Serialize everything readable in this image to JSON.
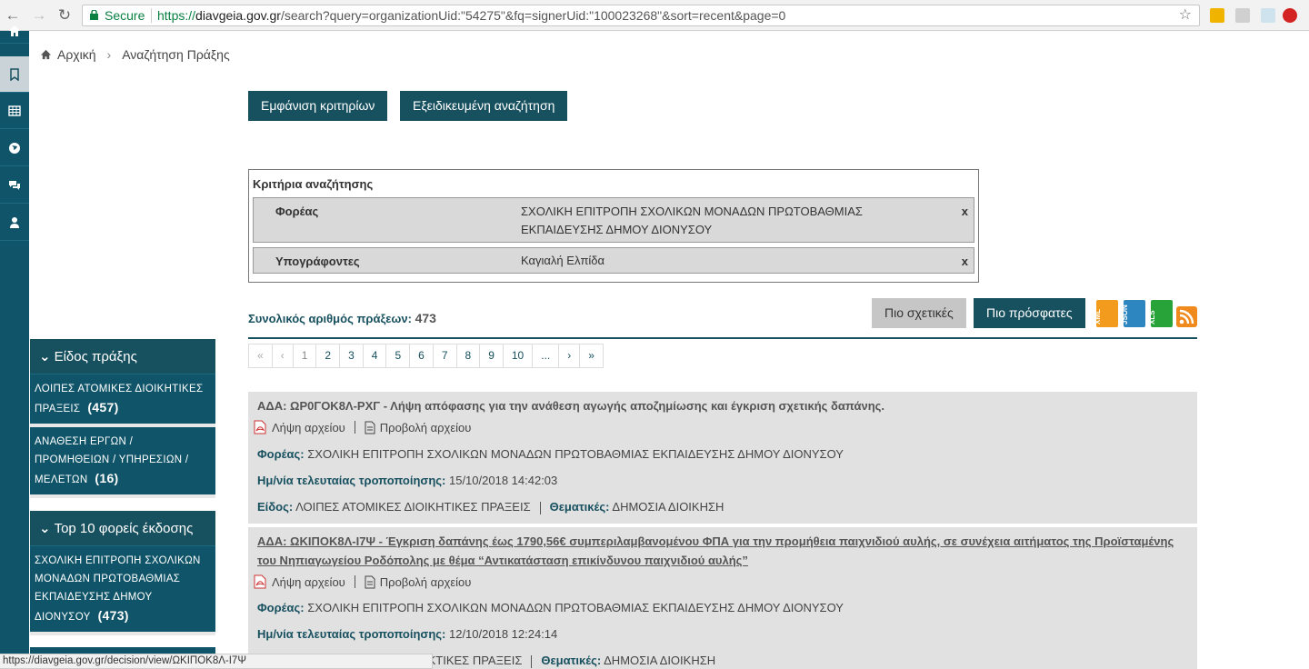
{
  "browser": {
    "secure_label": "Secure",
    "url_proto": "https://",
    "url_host": "diavgeia.gov.gr",
    "url_path": "/search?query=organizationUid:\"54275\"&fq=signerUid:\"100023268\"&sort=recent&page=0"
  },
  "breadcrumb": {
    "home": "Αρχική",
    "current": "Αναζήτηση Πράξης"
  },
  "toolbar": {
    "show_criteria": "Εμφάνιση κριτηρίων",
    "advanced_search": "Εξειδικευμένη αναζήτηση"
  },
  "criteria": {
    "title": "Κριτήρια αναζήτησης",
    "rows": [
      {
        "key": "Φορέας",
        "value": "ΣΧΟΛΙΚΗ ΕΠΙΤΡΟΠΗ ΣΧΟΛΙΚΩΝ ΜΟΝΑΔΩΝ ΠΡΩΤΟΒΑΘΜΙΑΣ ΕΚΠΑΙΔΕΥΣΗΣ ΔΗΜΟΥ ΔΙΟΝΥΣΟΥ",
        "remove": "x"
      },
      {
        "key": "Υπογράφοντες",
        "value": "Καγιαλή Ελπίδα",
        "remove": "x"
      }
    ]
  },
  "results": {
    "total_label": "Συνολικός αριθμός πράξεων:",
    "total": "473",
    "sort_relevant": "Πιο σχετικές",
    "sort_recent": "Πιο πρόσφατες",
    "exports": [
      "XML",
      "JSON",
      "XLS",
      "RSS"
    ]
  },
  "pagination": [
    "«",
    "‹",
    "1",
    "2",
    "3",
    "4",
    "5",
    "6",
    "7",
    "8",
    "9",
    "10",
    "...",
    "›",
    "»"
  ],
  "facets": [
    {
      "title": "Είδος πράξης",
      "items": [
        {
          "label": "ΛΟΙΠΕΣ ΑΤΟΜΙΚΕΣ ΔΙΟΙΚΗΤΙΚΕΣ ΠΡΑΞΕΙΣ",
          "count": "(457)"
        },
        {
          "label": "ΑΝΑΘΕΣΗ ΕΡΓΩΝ / ΠΡΟΜΗΘΕΙΩΝ / ΥΠΗΡΕΣΙΩΝ / ΜΕΛΕΤΩΝ",
          "count": "(16)"
        }
      ]
    },
    {
      "title": "Top 10 φορείς έκδοσης",
      "items": [
        {
          "label": "ΣΧΟΛΙΚΗ ΕΠΙΤΡΟΠΗ ΣΧΟΛΙΚΩΝ ΜΟΝΑΔΩΝ ΠΡΩΤΟΒΑΘΜΙΑΣ ΕΚΠΑΙΔΕΥΣΗΣ ΔΗΜΟΥ ΔΙΟΝΥΣΟΥ",
          "count": "(473)"
        }
      ]
    }
  ],
  "cards": [
    {
      "title": "ΑΔΑ: ΩΡ0ΓΟΚ8Λ-ΡΧΓ - Λήψη απόφασης για την ανάθεση αγωγής αποζημίωσης και έγκριση σχετικής δαπάνης.",
      "download": "Λήψη αρχείου",
      "view": "Προβολή αρχείου",
      "org_label": "Φορέας:",
      "org": "ΣΧΟΛΙΚΗ ΕΠΙΤΡΟΠΗ ΣΧΟΛΙΚΩΝ ΜΟΝΑΔΩΝ ΠΡΩΤΟΒΑΘΜΙΑΣ ΕΚΠΑΙΔΕΥΣΗΣ ΔΗΜΟΥ ΔΙΟΝΥΣΟΥ",
      "date_label": "Ημ/νία τελευταίας τροποποίησης:",
      "date": "15/10/2018 14:42:03",
      "type_label": "Είδος:",
      "type": "ΛΟΙΠΕΣ ΑΤΟΜΙΚΕΣ ΔΙΟΙΚΗΤΙΚΕΣ ΠΡΑΞΕΙΣ",
      "topic_label": "Θεματικές:",
      "topic": "ΔΗΜΟΣΙΑ ΔΙΟΙΚΗΣΗ"
    },
    {
      "title": "ΑΔΑ: ΩΚΙΠΟΚ8Λ-Ι7Ψ - Έγκριση δαπάνης έως 1790,56€ συμπεριλαμβανομένου ΦΠΑ για την προμήθεια παιχνιδιού αυλής, σε συνέχεια αιτήματος της Προϊσταμένης του Νηπιαγωγείου Ροδόπολης με θέμα “Αντικατάσταση επικίνδυνου παιχνιδιού αυλής”",
      "download": "Λήψη αρχείου",
      "view": "Προβολή αρχείου",
      "org_label": "Φορέας:",
      "org": "ΣΧΟΛΙΚΗ ΕΠΙΤΡΟΠΗ ΣΧΟΛΙΚΩΝ ΜΟΝΑΔΩΝ ΠΡΩΤΟΒΑΘΜΙΑΣ ΕΚΠΑΙΔΕΥΣΗΣ ΔΗΜΟΥ ΔΙΟΝΥΣΟΥ",
      "date_label": "Ημ/νία τελευταίας τροποποίησης:",
      "date": "12/10/2018 12:24:14",
      "type_partial": "ΙΚΤΙΚΕΣ ΠΡΑΞΕΙΣ",
      "topic_label": "Θεματικές:",
      "topic": "ΔΗΜΟΣΙΑ ΔΙΟΙΚΗΣΗ"
    }
  ],
  "status_url": "https://diavgeia.gov.gr/decision/view/ΩΚΙΠΟΚ8Λ-Ι7Ψ",
  "colors": {
    "primary": "#17505f",
    "rail": "#0f5468",
    "card": "#e1e1e1"
  }
}
